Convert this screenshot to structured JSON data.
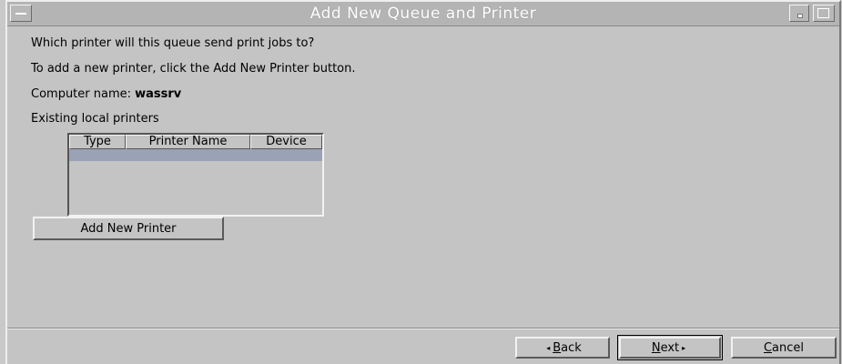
{
  "window": {
    "title": "Add New Queue and Printer"
  },
  "content": {
    "question": "Which printer will this queue send print jobs to?",
    "instruction": "To add a new printer, click the Add New Printer button.",
    "computer_label": "Computer name: ",
    "computer_name": "wassrv",
    "existing_label": "Existing local printers"
  },
  "table": {
    "columns": [
      "Type",
      "Printer Name",
      "Device"
    ],
    "rows": []
  },
  "buttons": {
    "add_printer": "Add New Printer",
    "back_accel": "B",
    "back_rest": "ack",
    "next_accel": "N",
    "next_rest": "ext",
    "cancel_accel": "C",
    "cancel_rest": "ancel"
  },
  "icons": {
    "back_arrow": "◂",
    "next_arrow": "▸"
  }
}
